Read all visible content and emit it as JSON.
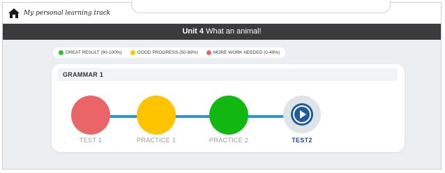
{
  "topbar": {
    "brand": "My personal learning track",
    "home_icon": "home-icon"
  },
  "unit": {
    "number_label": "Unit 4",
    "title": "What an animal!"
  },
  "legend": [
    {
      "label": "GREAT RESULT (90-100%)",
      "color": "#2fbf2f"
    },
    {
      "label": "GOOD PROGRESS (50-89%)",
      "color": "#ffc400"
    },
    {
      "label": "MORE WORK NEEDED (0-49%)",
      "color": "#e96567"
    }
  ],
  "card": {
    "title": "GRAMMAR 1",
    "line_color": "#2f95d8",
    "steps": [
      {
        "label": "TEST 1",
        "status_color": "#e96567"
      },
      {
        "label": "PRACTICE 1",
        "status_color": "#ffc400"
      },
      {
        "label": "PRACTICE 2",
        "status_color": "#12b812"
      },
      {
        "label": "TEST2",
        "status": "current",
        "icon": "play-icon",
        "accent": "#1f5c99"
      }
    ]
  }
}
